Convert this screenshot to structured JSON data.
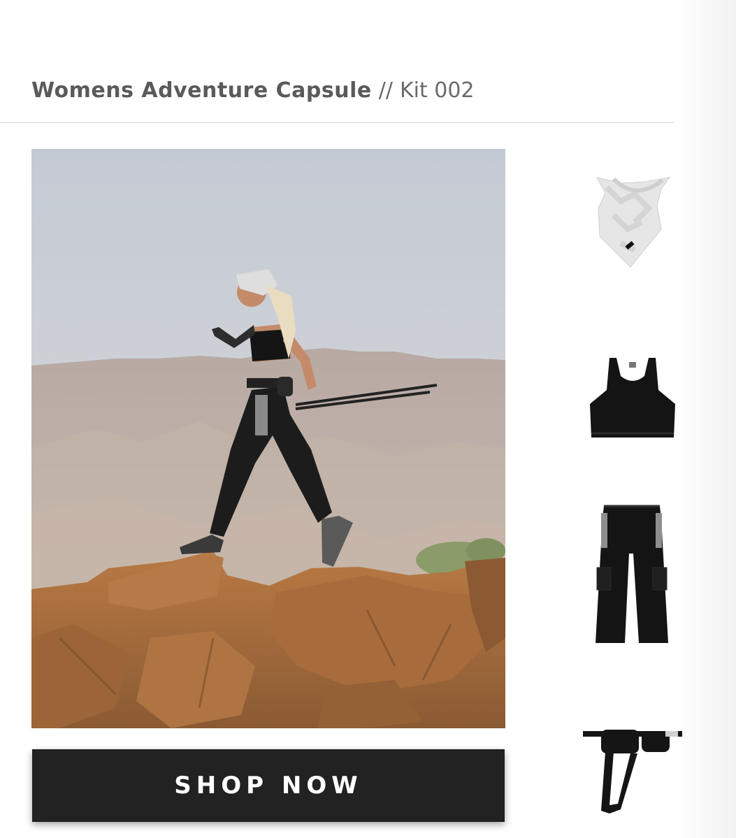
{
  "header": {
    "title": "Womens Adventure Capsule",
    "separator": "//",
    "kit": "Kit 002"
  },
  "hero": {
    "icon": "hiker-on-desert-ridge-photo"
  },
  "cta": {
    "label": "SHOP NOW"
  },
  "products": [
    {
      "icon": "bandana-icon"
    },
    {
      "icon": "sports-bra-icon"
    },
    {
      "icon": "cargo-pants-icon"
    },
    {
      "icon": "belt-bag-icon"
    }
  ],
  "colors": {
    "button_bg": "#222222",
    "button_text": "#ffffff",
    "header_text": "#5a5a5a",
    "divider": "#d6d6d6"
  }
}
